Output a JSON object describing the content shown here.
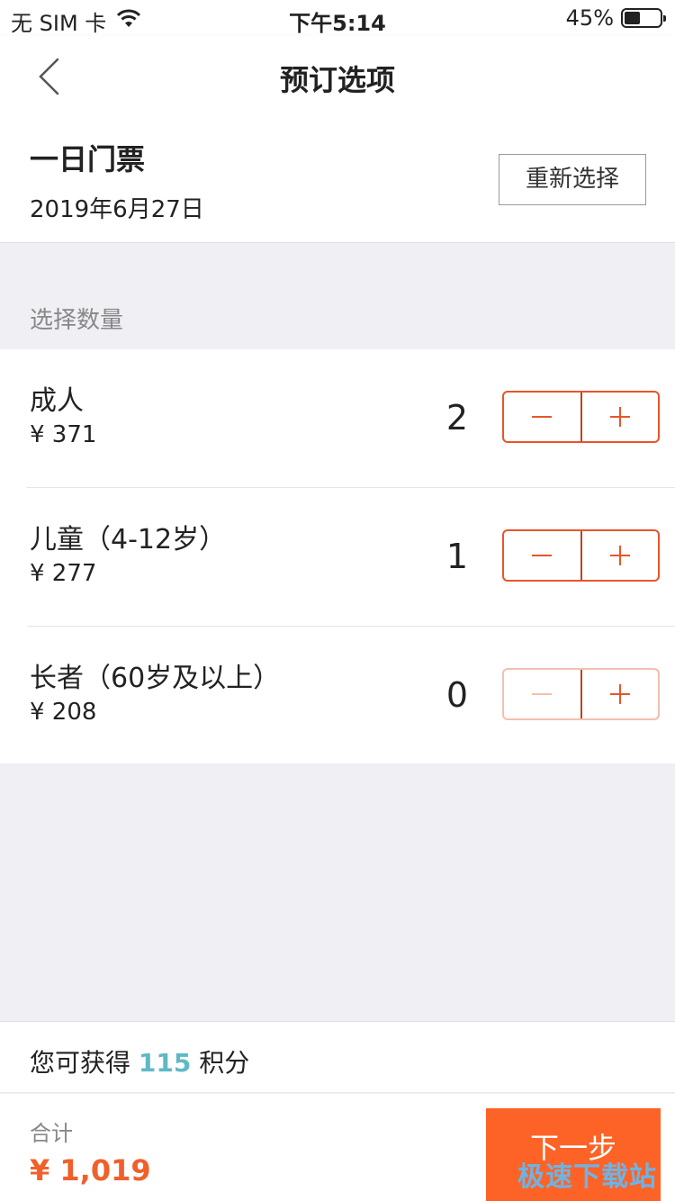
{
  "status_bar": {
    "carrier": "无 SIM 卡",
    "time": "下午5:14",
    "battery_percent": "45%",
    "battery_level": 0.45,
    "wifi_icon": "wifi-icon"
  },
  "nav": {
    "title": "预订选项",
    "back_icon": "chevron-left-icon"
  },
  "ticket": {
    "name": "一日门票",
    "date": "2019年6月27日",
    "reselect_label": "重新选择"
  },
  "section_label": "选择数量",
  "quantities": [
    {
      "name": "成人",
      "price": "¥ 371",
      "count": "2",
      "minus_enabled": true,
      "plus_enabled": true
    },
    {
      "name": "儿童（4-12岁）",
      "price": "¥ 277",
      "count": "1",
      "minus_enabled": true,
      "plus_enabled": true
    },
    {
      "name": "长者（60岁及以上）",
      "price": "¥ 208",
      "count": "0",
      "minus_enabled": false,
      "plus_enabled": true
    }
  ],
  "points": {
    "prefix": "您可获得",
    "value": "115",
    "suffix": "积分"
  },
  "footer": {
    "total_label": "合计",
    "total_amount": "¥ 1,019",
    "next_label": "下一步"
  },
  "watermark": "极速下载站",
  "colors": {
    "accent": "#fd6326",
    "stepper_border": "#e8552b",
    "points": "#5fb9c5",
    "background": "#efeff4"
  }
}
